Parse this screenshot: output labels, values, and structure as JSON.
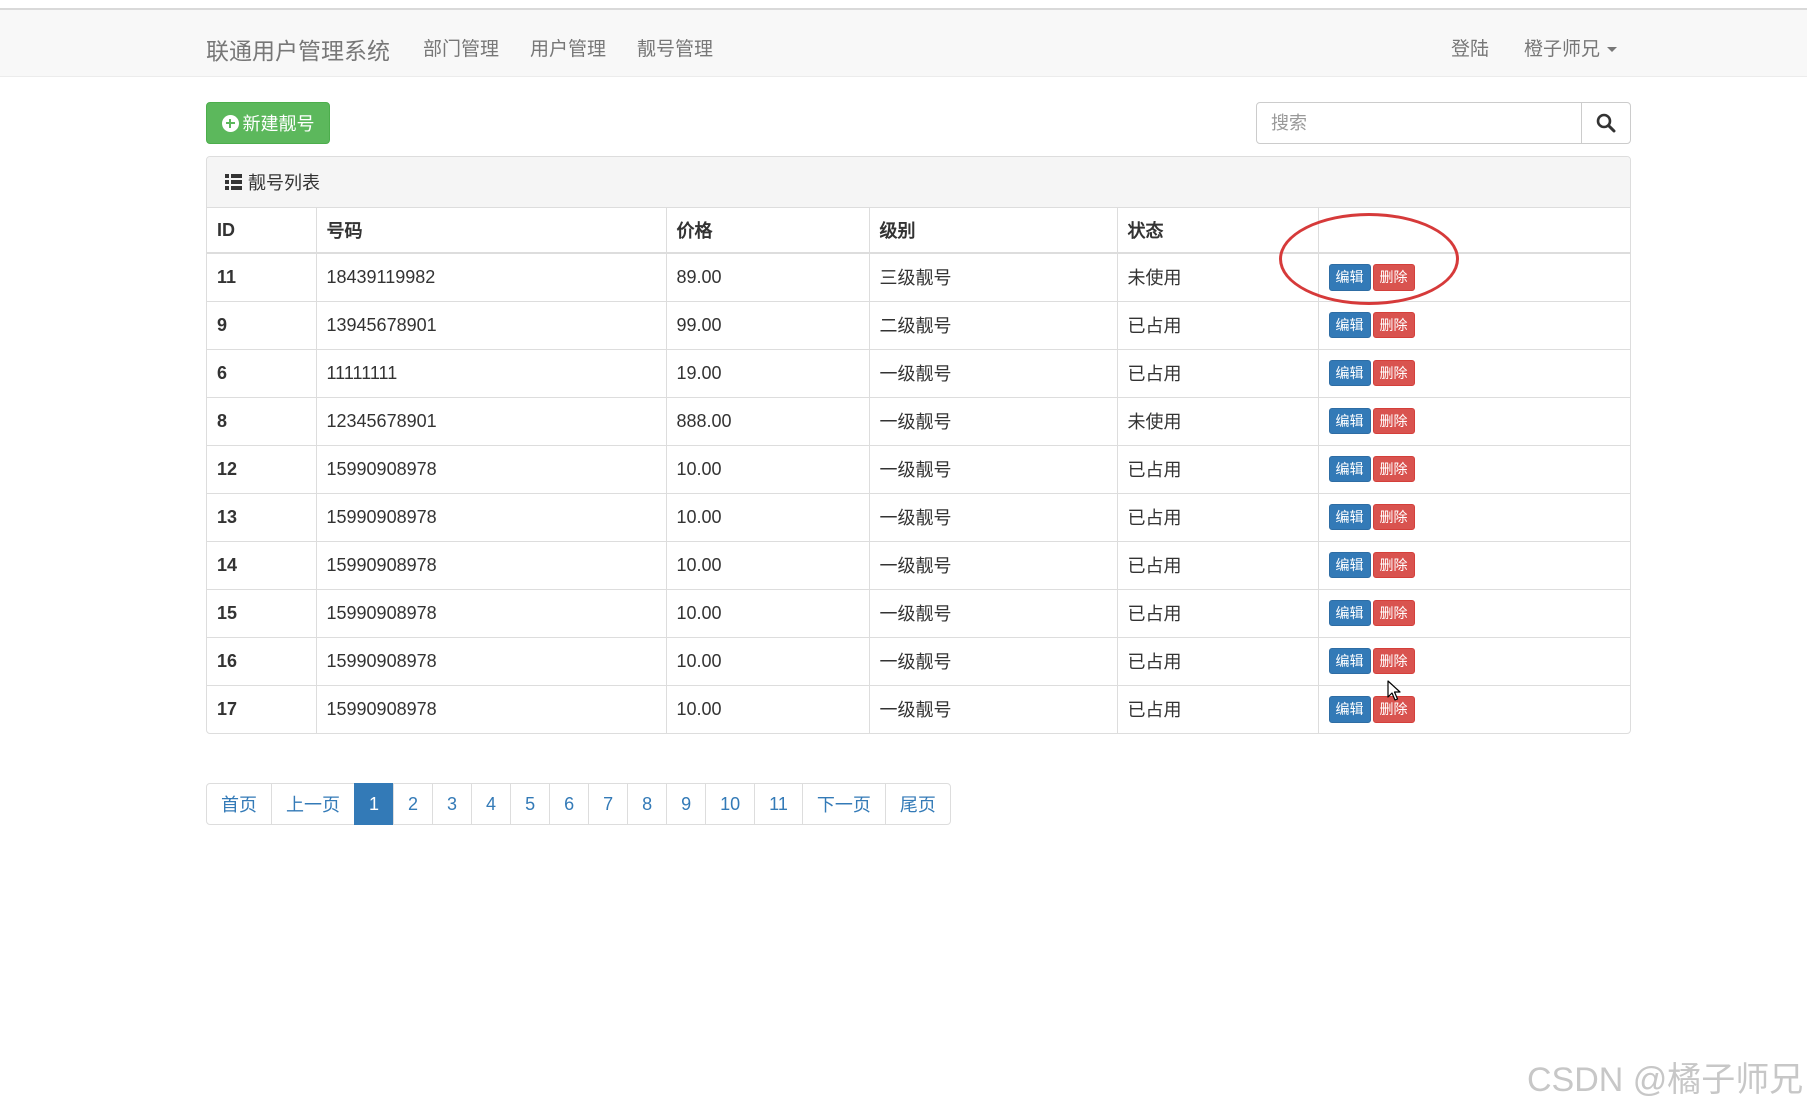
{
  "navbar": {
    "brand": "联通用户管理系统",
    "links": [
      "部门管理",
      "用户管理",
      "靓号管理"
    ],
    "login": "登陆",
    "user": "橙子师兄"
  },
  "toolbar": {
    "new_button": "新建靓号",
    "search_placeholder": "搜索"
  },
  "panel": {
    "title": "靓号列表",
    "columns": [
      "ID",
      "号码",
      "价格",
      "级别",
      "状态",
      ""
    ],
    "edit_label": "编辑",
    "delete_label": "删除",
    "rows": [
      {
        "id": "11",
        "mobile": "18439119982",
        "price": "89.00",
        "level": "三级靓号",
        "status": "未使用"
      },
      {
        "id": "9",
        "mobile": "13945678901",
        "price": "99.00",
        "level": "二级靓号",
        "status": "已占用"
      },
      {
        "id": "6",
        "mobile": "11111111",
        "price": "19.00",
        "level": "一级靓号",
        "status": "已占用"
      },
      {
        "id": "8",
        "mobile": "12345678901",
        "price": "888.00",
        "level": "一级靓号",
        "status": "未使用"
      },
      {
        "id": "12",
        "mobile": "15990908978",
        "price": "10.00",
        "level": "一级靓号",
        "status": "已占用"
      },
      {
        "id": "13",
        "mobile": "15990908978",
        "price": "10.00",
        "level": "一级靓号",
        "status": "已占用"
      },
      {
        "id": "14",
        "mobile": "15990908978",
        "price": "10.00",
        "level": "一级靓号",
        "status": "已占用"
      },
      {
        "id": "15",
        "mobile": "15990908978",
        "price": "10.00",
        "level": "一级靓号",
        "status": "已占用"
      },
      {
        "id": "16",
        "mobile": "15990908978",
        "price": "10.00",
        "level": "一级靓号",
        "status": "已占用"
      },
      {
        "id": "17",
        "mobile": "15990908978",
        "price": "10.00",
        "level": "一级靓号",
        "status": "已占用"
      }
    ]
  },
  "pagination": {
    "items": [
      "首页",
      "上一页",
      "1",
      "2",
      "3",
      "4",
      "5",
      "6",
      "7",
      "8",
      "9",
      "10",
      "11",
      "下一页",
      "尾页"
    ],
    "active": "1"
  },
  "watermark": "CSDN @橘子师兄",
  "colors": {
    "primary": "#337ab7",
    "success": "#5cb85c",
    "danger": "#d9534f",
    "annotation": "#d63a3a"
  }
}
